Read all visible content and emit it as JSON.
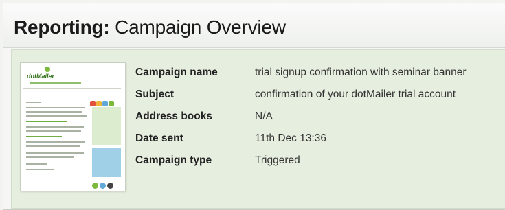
{
  "header": {
    "title_prefix": "Reporting:",
    "title_text": "Campaign Overview"
  },
  "thumbnail": {
    "icon": "email-preview-thumbnail"
  },
  "details": [
    {
      "label": "Campaign name",
      "value": "trial signup confirmation with seminar banner"
    },
    {
      "label": "Subject",
      "value": "confirmation of your dotMailer trial account"
    },
    {
      "label": "Address books",
      "value": "N/A"
    },
    {
      "label": "Date sent",
      "value": "11th Dec 13:36"
    },
    {
      "label": "Campaign type",
      "value": "Triggered"
    }
  ],
  "colors": {
    "panel_bg": "#e6eedf",
    "header_bg": "#fbfbfb",
    "brand_green": "#6fae45"
  }
}
